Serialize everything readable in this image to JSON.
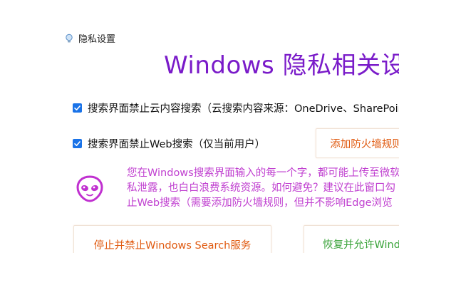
{
  "window": {
    "title": "隐私设置"
  },
  "heading": "Windows 隐私相关设置",
  "options": [
    {
      "label": "搜索界面禁止云内容搜索（云搜索内容来源：OneDrive、SharePoint",
      "checked": true
    },
    {
      "label": "搜索界面禁止Web搜索（仅当前用户）",
      "checked": true
    }
  ],
  "buttons": {
    "add_firewall_rule": "添加防火墙规则",
    "stop_search_service": "停止并禁止Windows Search服务",
    "restore_search_service": "恢复并允许Windows Search服务"
  },
  "info": {
    "icon": "alien-icon",
    "lines": [
      "您在Windows搜索界面输入的每一个字，都可能上传至微软",
      "私泄露，也白白浪费系统资源。如何避免？建议在此窗口勾",
      "止Web搜索（需要添加防火墙规则，但并不影响Edge浏览"
    ]
  },
  "colors": {
    "heading": "#7a1bc9",
    "checkbox": "#1a73e8",
    "warning_button_text": "#e05a10",
    "info_text": "#c040d0",
    "restore_button_text": "#3aa33a"
  }
}
